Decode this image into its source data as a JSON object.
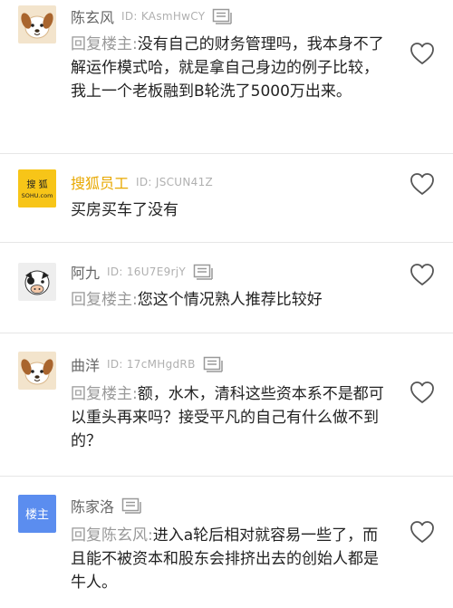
{
  "colors": {
    "name": "#666666",
    "brand_name": "#e8a800",
    "uid": "#b0b0b0",
    "text": "#222222",
    "reply_prefix": "#999999",
    "divider": "#e6e6e6",
    "author_badge_bg": "#5b8def"
  },
  "comments": [
    {
      "avatar": "dog-avatar",
      "name": "陈玄风",
      "uid": "ID: KAsmHwCY",
      "reply_prefix": "回复楼主:",
      "text": "没有自己的财务管理吗，我本身不了解运作模式哈，就是拿自己身边的例子比较，我上一个老板融到B轮洗了5000万出来。"
    },
    {
      "avatar": "sohu-logo-avatar",
      "avatar_label_top": "搜 狐",
      "avatar_label_bottom": "SOHU.com",
      "name": "搜狐员工",
      "uid": "ID: JSCUN41Z",
      "reply_prefix": "",
      "text": "买房买车了没有"
    },
    {
      "avatar": "cow-avatar",
      "name": "阿九",
      "uid": "ID: 16U7E9rjY",
      "reply_prefix": "回复楼主:",
      "text": "您这个情况熟人推荐比较好"
    },
    {
      "avatar": "dog-avatar",
      "name": "曲洋",
      "uid": "ID: 17cMHgdRB",
      "reply_prefix": "回复楼主:",
      "text": "额，水木，清科这些资本系不是都可以重头再来吗？接受平凡的自己有什么做不到的？"
    },
    {
      "avatar": "author-badge-avatar",
      "avatar_label": "楼主",
      "name": "陈家洛",
      "uid": "",
      "reply_prefix": "回复陈玄风:",
      "text": "进入a轮后相对就容易一些了，而且能不被资本和股东会排挤出去的创始人都是牛人。"
    }
  ]
}
